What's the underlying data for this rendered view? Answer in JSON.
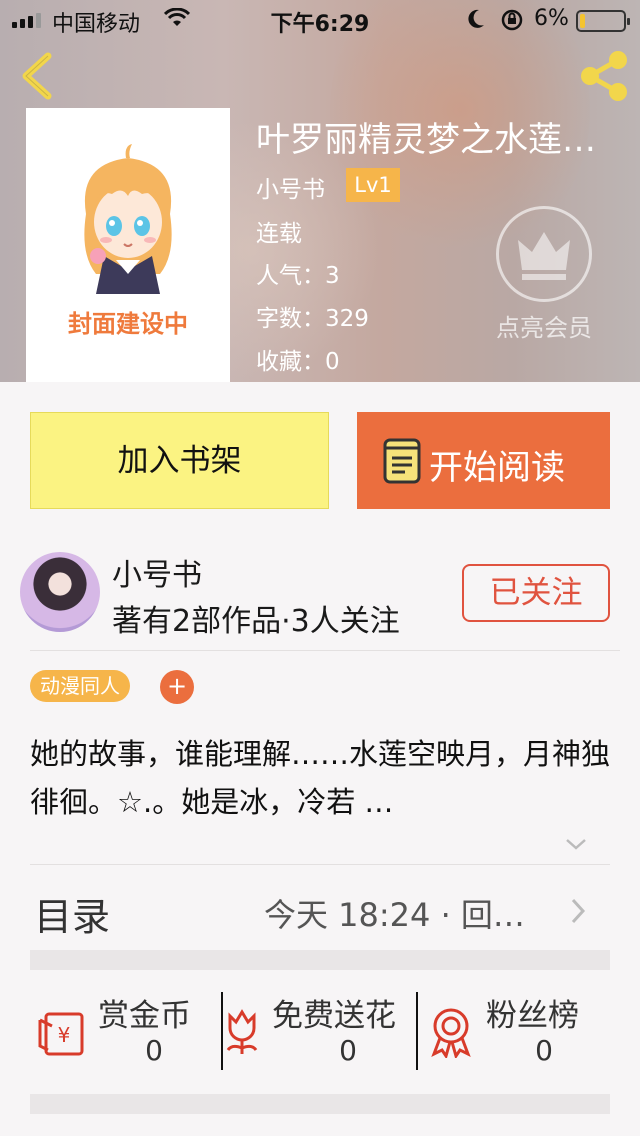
{
  "status_bar": {
    "carrier": "中国移动",
    "time": "下午6:29",
    "battery": "6%"
  },
  "book": {
    "title": "叶罗丽精灵梦之水莲空映月",
    "cover_text": "封面建设中",
    "author": "小号书",
    "level": "Lv1",
    "status": "连载",
    "popularity_label": "人气：",
    "popularity": "3",
    "word_count_label": "字数：",
    "word_count": "329",
    "favorites_label": "收藏：",
    "favorites": "0"
  },
  "vip": {
    "label": "点亮会员"
  },
  "buttons": {
    "add_shelf": "加入书架",
    "start_reading": "开始阅读"
  },
  "author_card": {
    "name": "小号书",
    "stats": "著有2部作品·3人关注",
    "follow": "已关注"
  },
  "tags": [
    {
      "label": "动漫同人"
    }
  ],
  "tag_add": "+",
  "synopsis": "她的故事，谁能理解……水莲空映月，月神独徘徊。☆.。她是冰，冷若 …",
  "toc": {
    "label": "目录",
    "latest": "今天 18:24 · 回…"
  },
  "actions": [
    {
      "label": "赏金币",
      "count": "0"
    },
    {
      "label": "免费送花",
      "count": "0"
    },
    {
      "label": "粉丝榜",
      "count": "0"
    }
  ],
  "colors": {
    "shelf_button": "#fbf382",
    "read_button": "#eb6e3e",
    "follow": "#e0533f",
    "level_badge": "#f6b54a",
    "icon_red": "#d83b2a"
  }
}
